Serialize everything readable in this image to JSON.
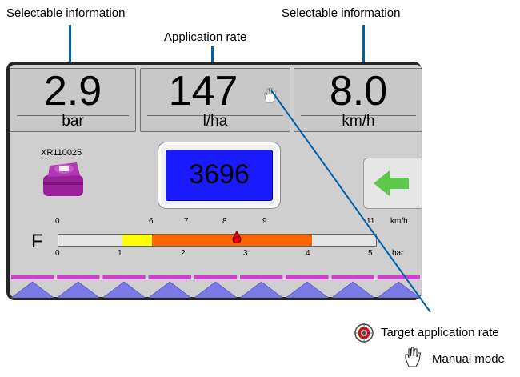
{
  "callouts": {
    "left": "Selectable information",
    "center": "Application rate",
    "right": "Selectable information"
  },
  "display": {
    "left_box": {
      "value": "2.9",
      "unit": "bar"
    },
    "center_box": {
      "value": "147",
      "unit": "l/ha",
      "mode_icon": "hand-icon"
    },
    "right_box": {
      "value": "8.0",
      "unit": "km/h"
    },
    "nozzle_label": "XR110025",
    "target_value": "3696",
    "speed_ticks": [
      "0",
      "6",
      "7",
      "8",
      "9",
      "11"
    ],
    "speed_unit": "km/h",
    "pressure_ticks": [
      "0",
      "1",
      "2",
      "3",
      "4",
      "5"
    ],
    "pressure_unit": "bar",
    "bar_label": "F",
    "sections": 9
  },
  "legend": {
    "target_rate": "Target application rate",
    "manual_mode": "Manual mode"
  },
  "colors": {
    "leader": "#0060a8",
    "target_bg": "#1a1aff",
    "nozzle": "#9a1f9a",
    "bar_yellow": "#ffff00",
    "bar_orange": "#ff6600",
    "marker_red": "#dd0000",
    "arrow_green": "#5ec84a",
    "boom_magenta": "#d23cd2",
    "boom_blue": "#7a7ae6"
  }
}
